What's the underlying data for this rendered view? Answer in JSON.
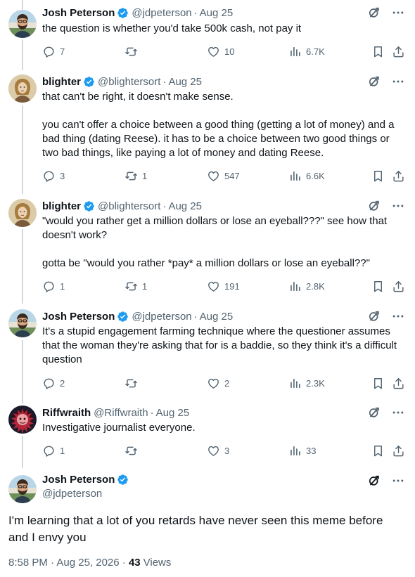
{
  "colors": {
    "accent": "#1d9bf0",
    "muted": "#536471",
    "text": "#0f1419",
    "thread_line": "#cfd9de"
  },
  "replies": [
    {
      "name": "Josh Peterson",
      "verified": true,
      "handle": "@jdpeterson",
      "date": "Aug 25",
      "text": "the question is whether you'd take 500k cash, not pay it",
      "replies": "7",
      "reposts": "",
      "likes": "10",
      "views": "6.7K",
      "avatar": "josh-avatar"
    },
    {
      "name": "blighter",
      "verified": true,
      "handle": "@blightersort",
      "date": "Aug 25",
      "text": "that can't be right, it doesn't make sense.\n\nyou can't offer a choice between a good thing (getting a lot of money) and a bad thing (dating Reese). it has to be a choice between two good things or two bad things, like paying a lot of money and dating Reese.",
      "replies": "3",
      "reposts": "1",
      "likes": "547",
      "views": "6.6K",
      "avatar": "blighter-avatar"
    },
    {
      "name": "blighter",
      "verified": true,
      "handle": "@blightersort",
      "date": "Aug 25",
      "text": "\"would you rather get a million dollars or lose an eyeball???\"  see how that doesn't work?\n\ngotta be \"would you rather *pay* a million dollars or lose an eyeball??\"",
      "replies": "1",
      "reposts": "1",
      "likes": "191",
      "views": "2.8K",
      "avatar": "blighter-avatar"
    },
    {
      "name": "Josh Peterson",
      "verified": true,
      "handle": "@jdpeterson",
      "date": "Aug 25",
      "text": "It's a stupid engagement farming technique where the questioner assumes that the woman they're asking that for is a baddie, so they think it's a difficult question",
      "replies": "2",
      "reposts": "",
      "likes": "2",
      "views": "2.3K",
      "avatar": "josh-avatar"
    },
    {
      "name": "Riffwraith",
      "verified": false,
      "handle": "@Riffwraith",
      "date": "Aug 25",
      "text": "Investigative journalist everyone.",
      "replies": "1",
      "reposts": "",
      "likes": "3",
      "views": "33",
      "avatar": "riffwraith-avatar"
    }
  ],
  "main_tweet": {
    "name": "Josh Peterson",
    "verified": true,
    "handle": "@jdpeterson",
    "text": "I'm learning that a lot of you retards have never seen this meme before and I envy you",
    "timestamp": "8:58 PM · Aug 25, 2026 · ",
    "views_count": "43",
    "views_label": "Views"
  },
  "separator": "·",
  "icons": [
    "verified-badge-icon",
    "grok-icon",
    "more-icon",
    "reply-icon",
    "repost-icon",
    "like-icon",
    "views-icon",
    "bookmark-icon",
    "share-icon"
  ]
}
